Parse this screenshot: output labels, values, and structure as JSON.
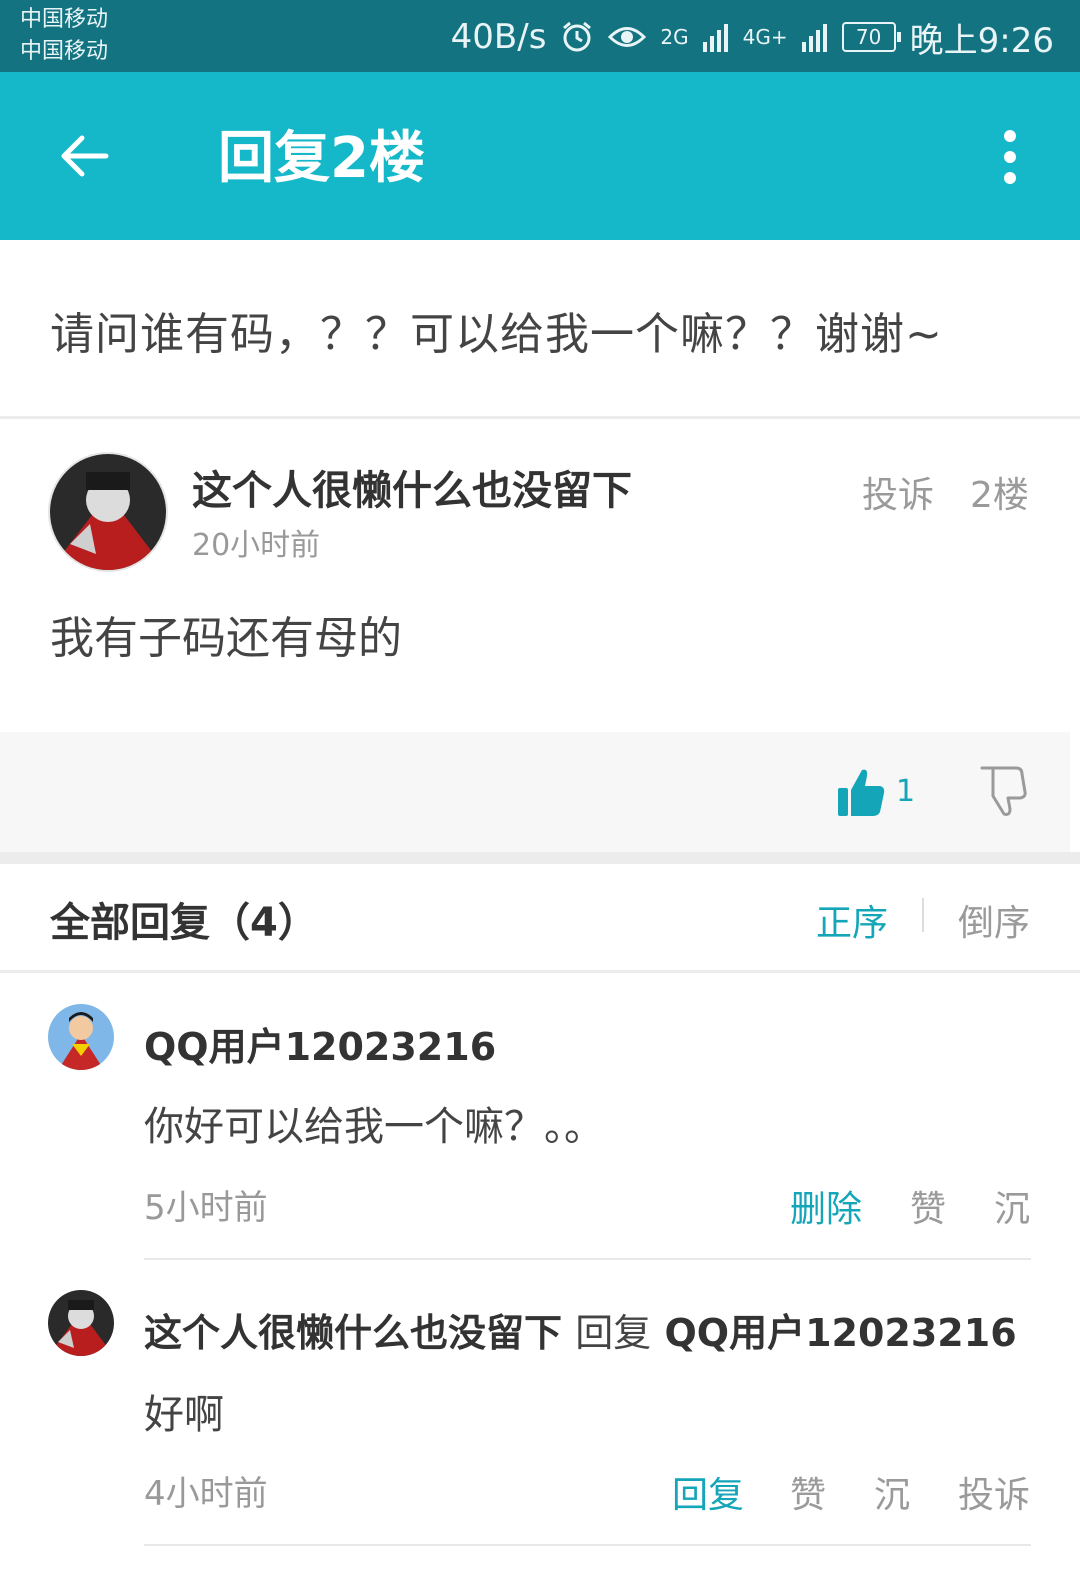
{
  "status_bar": {
    "carrier_1": "中国移动",
    "carrier_2": "中国移动",
    "speed": "40B/s",
    "net_1": "2G",
    "net_2": "4G+",
    "battery": "70",
    "time": "晚上9:26"
  },
  "app_bar": {
    "title": "回复2楼",
    "back_icon": "arrow-left-icon",
    "more_icon": "more-vert-icon"
  },
  "question": "请问谁有码，？？可以给我一个嘛？？谢谢~",
  "post": {
    "author": "这个人很懒什么也没留下",
    "time": "20小时前",
    "report_label": "投诉",
    "floor": "2楼",
    "body": "我有子码还有母的",
    "like_count": "1"
  },
  "replies_header": {
    "title": "全部回复（4）",
    "sort_asc": "正序",
    "sort_desc": "倒序"
  },
  "replies": [
    {
      "author": "QQ用户12023216",
      "body": "你好可以给我一个嘛？。。",
      "time": "5小时前",
      "actions": [
        "删除",
        "赞",
        "沉"
      ]
    },
    {
      "author": "这个人很懒什么也没留下",
      "reply_word": "回复",
      "reply_to": "QQ用户12023216",
      "body": "好啊",
      "time": "4小时前",
      "actions": [
        "回复",
        "赞",
        "沉",
        "投诉"
      ]
    }
  ],
  "colors": {
    "status_bar": "#137381",
    "app_bar": "#14b8c8",
    "accent": "#14a6b8"
  }
}
